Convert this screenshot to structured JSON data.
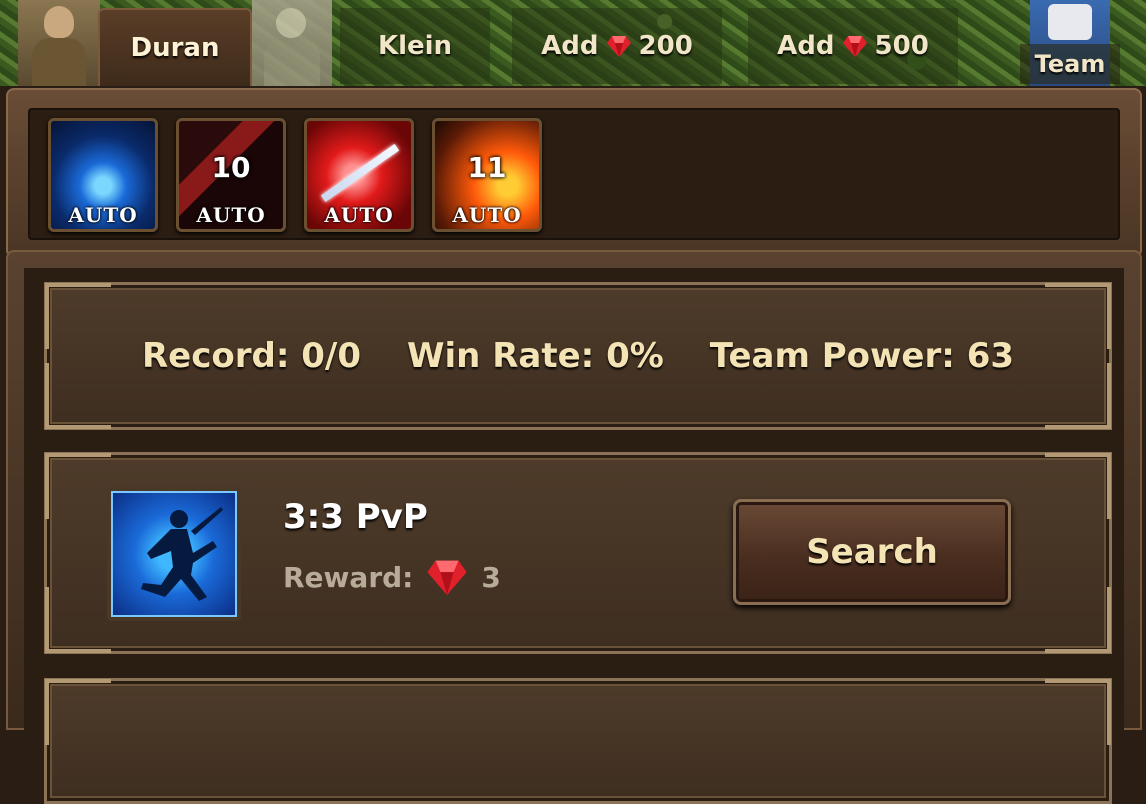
{
  "top_tabs": {
    "duran": "Duran",
    "klein": "Klein",
    "add_label_1": "Add",
    "add_amount_1": "200",
    "add_label_2": "Add",
    "add_amount_2": "500",
    "team": "Team"
  },
  "skills": [
    {
      "auto": "AUTO",
      "count": "",
      "icon": "blue-flame-icon"
    },
    {
      "auto": "AUTO",
      "count": "10",
      "icon": "dark-slash-icon"
    },
    {
      "auto": "AUTO",
      "count": "",
      "icon": "red-blade-icon"
    },
    {
      "auto": "AUTO",
      "count": "11",
      "icon": "fire-hammer-icon"
    }
  ],
  "stats": {
    "record": "Record: 0/0",
    "win_rate": "Win Rate: 0%",
    "team_power": "Team Power: 63"
  },
  "pvp": {
    "title": "3:3 PvP",
    "reward_label": "Reward:",
    "reward_amount": "3",
    "search_label": "Search"
  },
  "colors": {
    "gem": "#e0202a",
    "text_gold": "#f4e3b4",
    "frame_brown": "#4e3b2a"
  }
}
